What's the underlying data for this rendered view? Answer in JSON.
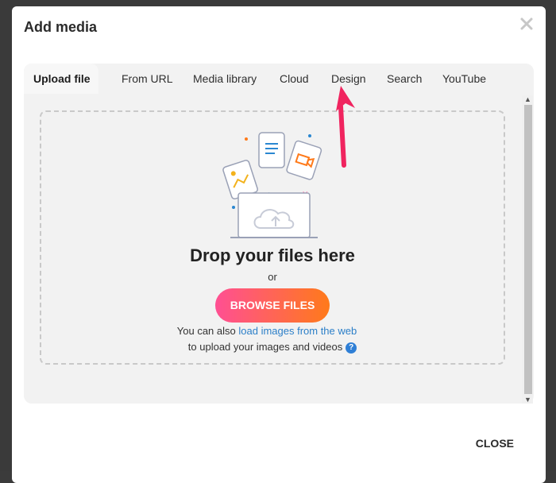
{
  "modal": {
    "title": "Add media",
    "close_label": "CLOSE"
  },
  "tabs": [
    {
      "label": "Upload file",
      "active": true
    },
    {
      "label": "From URL",
      "active": false
    },
    {
      "label": "Media library",
      "active": false
    },
    {
      "label": "Cloud",
      "active": false
    },
    {
      "label": "Design",
      "active": false
    },
    {
      "label": "Search",
      "active": false
    },
    {
      "label": "YouTube",
      "active": false
    }
  ],
  "dropzone": {
    "title": "Drop your files here",
    "or": "or",
    "browse_label": "BROWSE FILES",
    "hint": "to upload your images and videos"
  },
  "web": {
    "prefix": "You can also",
    "link": "load images from the web"
  },
  "icons": {
    "close": "close-x-icon",
    "help": "question-circle-icon",
    "illustration": "cloud-upload-laptop-illustration",
    "annotation": "pink-arrow-pointer"
  },
  "colors": {
    "accent_pink": "#ff4f93",
    "accent_orange": "#ff7a1a",
    "link": "#2c7fc8",
    "annotation_arrow": "#f0245f"
  }
}
